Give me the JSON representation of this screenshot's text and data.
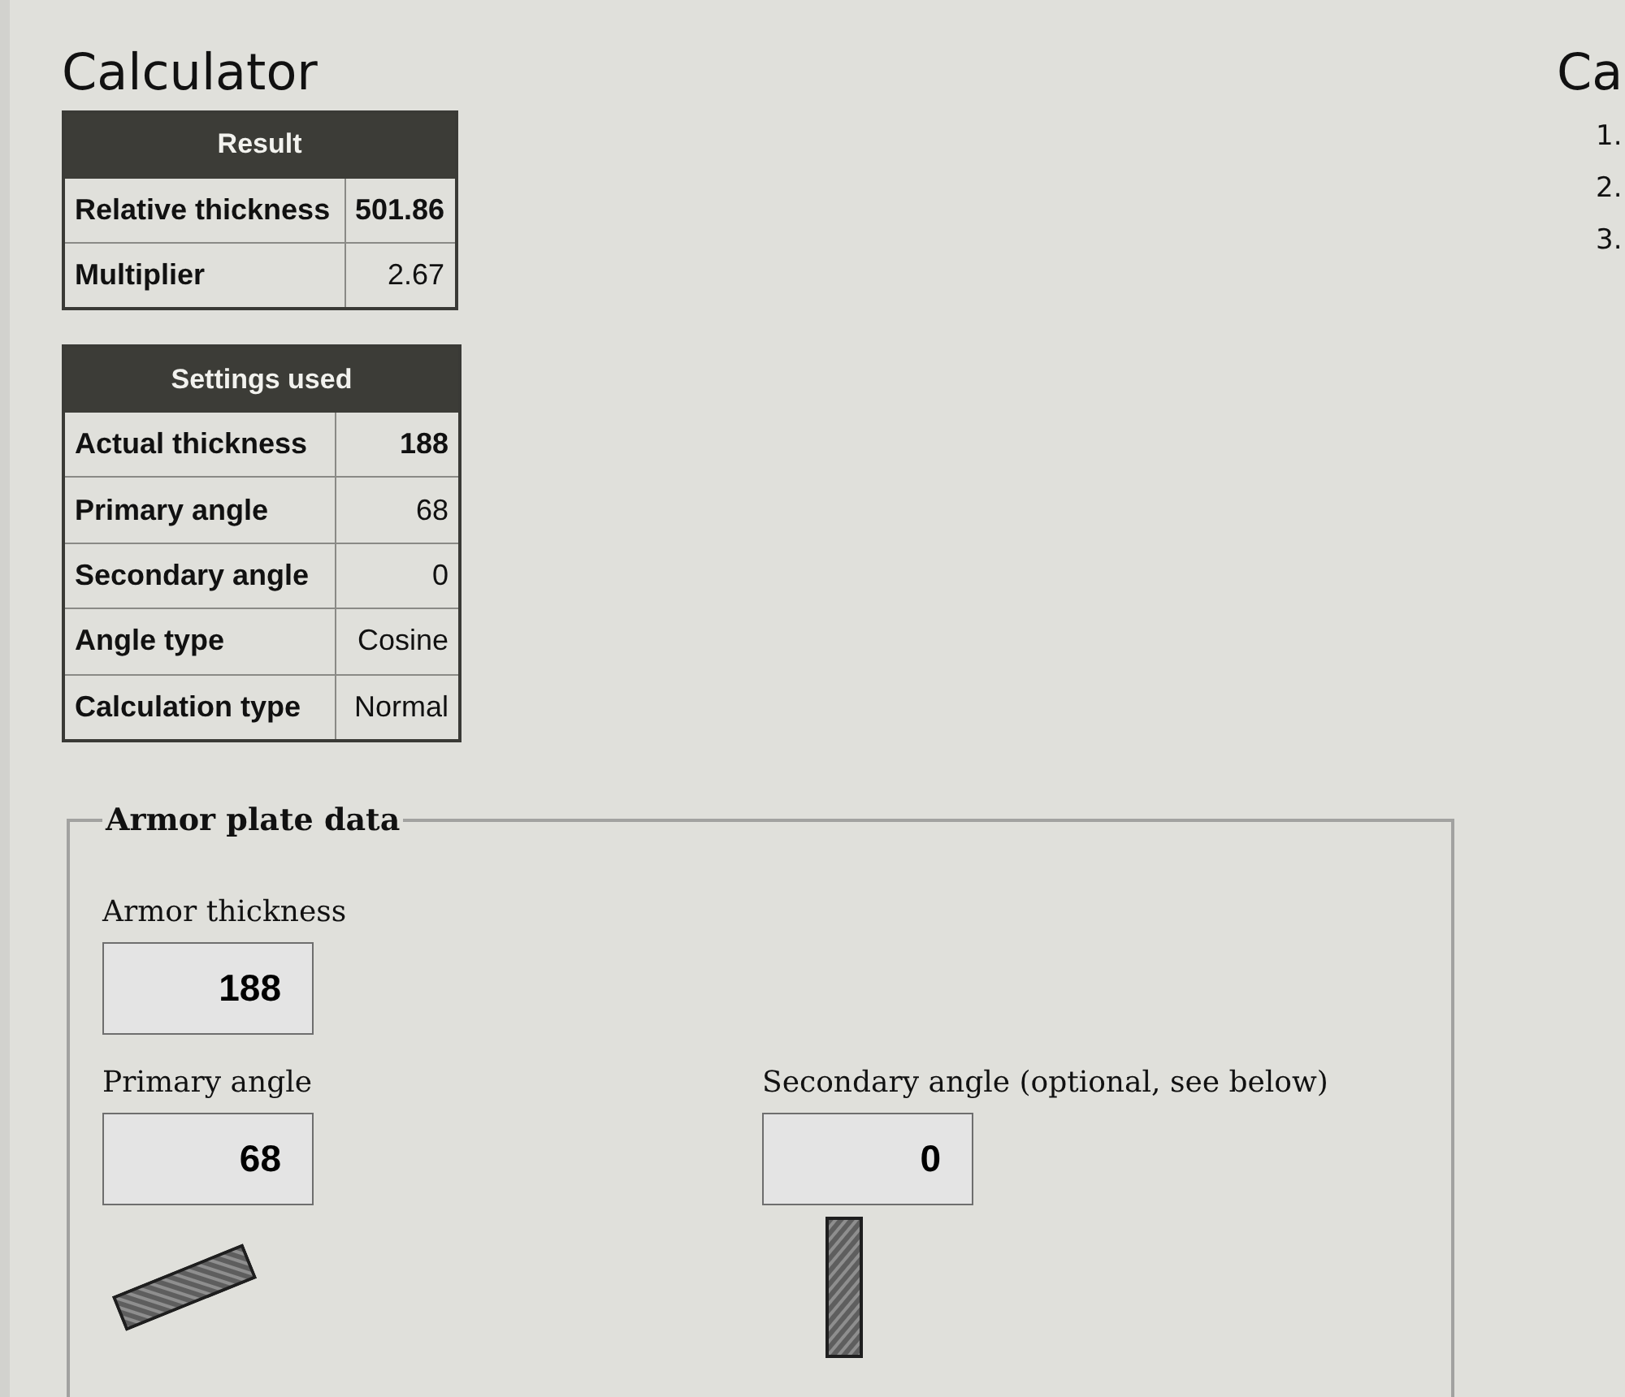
{
  "title": "Calculator",
  "result_table": {
    "header": "Result",
    "rows": [
      {
        "label": "Relative thickness",
        "value": "501.86",
        "bold": true
      },
      {
        "label": "Multiplier",
        "value": "2.67",
        "bold": false
      }
    ]
  },
  "settings_table": {
    "header": "Settings used",
    "rows": [
      {
        "label": "Actual thickness",
        "value": "188",
        "bold": true
      },
      {
        "label": "Primary angle",
        "value": "68",
        "bold": false
      },
      {
        "label": "Secondary angle",
        "value": "0",
        "bold": false
      },
      {
        "label": "Angle type",
        "value": "Cosine",
        "bold": false
      },
      {
        "label": "Calculation type",
        "value": "Normal",
        "bold": false
      }
    ]
  },
  "armor_plate_data": {
    "legend": "Armor plate data",
    "fields": [
      {
        "kind": "thickness",
        "label": "Armor thickness",
        "value": "188"
      },
      {
        "kind": "angle",
        "label": "Primary angle",
        "value": "68"
      },
      {
        "kind": "angle",
        "label": "Secondary angle (optional, see below)",
        "value": "0"
      }
    ]
  },
  "side_panel": {
    "heading": "Ca",
    "items": [
      "1.",
      "2.",
      "3."
    ]
  }
}
